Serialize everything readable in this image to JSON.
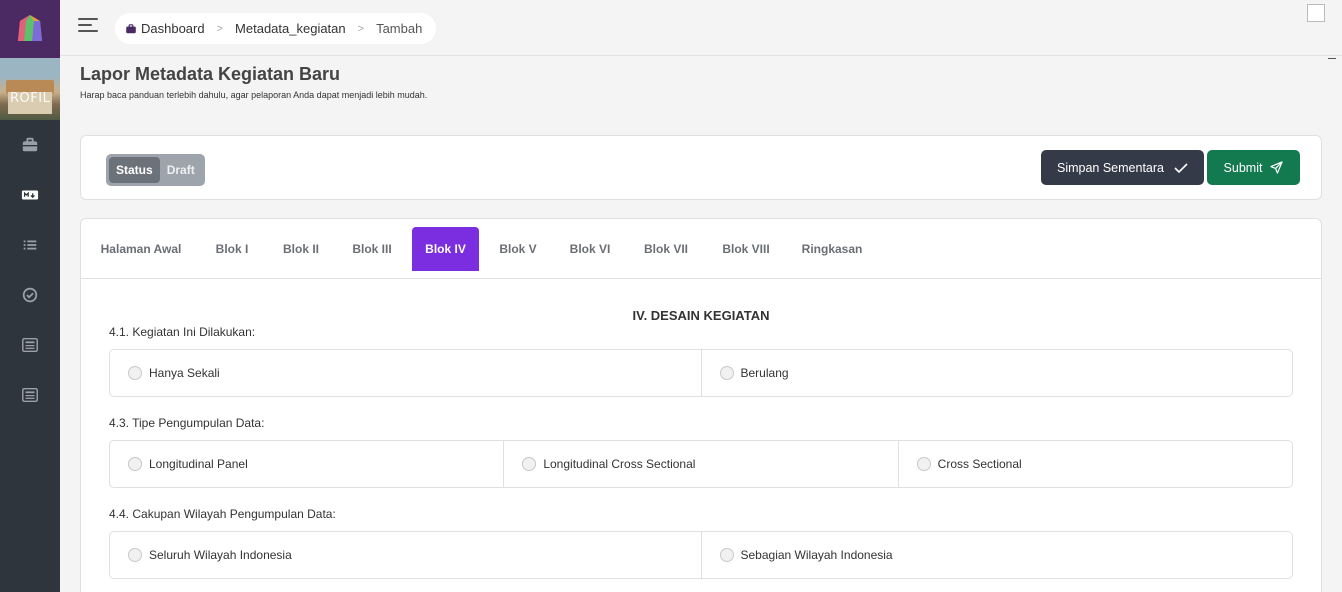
{
  "colors": {
    "sidebar_bg": "#2f353c",
    "logo_bg": "#4b2a63",
    "active_tab": "#7b2de0",
    "save_button": "#343a48",
    "submit_button": "#137a4f"
  },
  "sidebar": {
    "logo_icon": "gem-logo-icon",
    "avatar_text": "ROFIL",
    "items": [
      {
        "icon": "briefcase-icon"
      },
      {
        "icon": "markdown-icon"
      },
      {
        "icon": "list-icon"
      },
      {
        "icon": "check-circle-icon"
      },
      {
        "icon": "newspaper-icon"
      },
      {
        "icon": "newspaper-icon"
      }
    ]
  },
  "breadcrumb": {
    "items": [
      "Dashboard",
      "Metadata_kegiatan",
      "Tambah"
    ]
  },
  "header": {
    "title": "Lapor Metadata Kegiatan Baru",
    "subtitle": "Harap baca panduan terlebih dahulu, agar pelaporan Anda dapat menjadi lebih mudah."
  },
  "status": {
    "label": "Status",
    "value": "Draft"
  },
  "actions": {
    "save_label": "Simpan Sementara",
    "submit_label": "Submit"
  },
  "tabs": [
    {
      "label": "Halaman Awal",
      "active": false
    },
    {
      "label": "Blok I",
      "active": false
    },
    {
      "label": "Blok II",
      "active": false
    },
    {
      "label": "Blok III",
      "active": false
    },
    {
      "label": "Blok IV",
      "active": true
    },
    {
      "label": "Blok V",
      "active": false
    },
    {
      "label": "Blok VI",
      "active": false
    },
    {
      "label": "Blok VII",
      "active": false
    },
    {
      "label": "Blok VIII",
      "active": false
    },
    {
      "label": "Ringkasan",
      "active": false
    }
  ],
  "section": {
    "title": "IV. DESAIN KEGIATAN",
    "questions": [
      {
        "label": "4.1. Kegiatan Ini Dilakukan:",
        "options": [
          "Hanya Sekali",
          "Berulang"
        ]
      },
      {
        "label": "4.3. Tipe Pengumpulan Data:",
        "options": [
          "Longitudinal Panel",
          "Longitudinal Cross Sectional",
          "Cross Sectional"
        ]
      },
      {
        "label": "4.4. Cakupan Wilayah Pengumpulan Data:",
        "options": [
          "Seluruh Wilayah Indonesia",
          "Sebagian Wilayah Indonesia"
        ]
      }
    ]
  }
}
